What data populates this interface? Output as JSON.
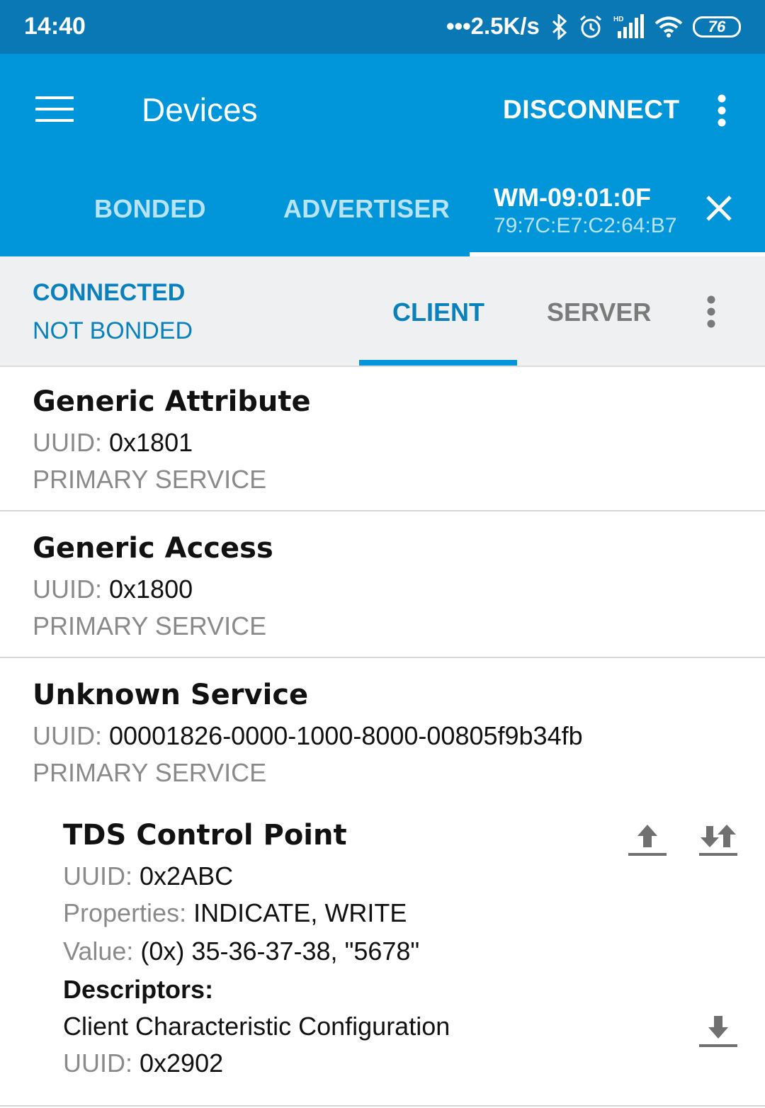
{
  "status_bar": {
    "time": "14:40",
    "network_speed": "•••2.5K/s",
    "battery": "76",
    "icons": [
      "bluetooth-icon",
      "alarm-icon",
      "signal-icon",
      "wifi-icon",
      "battery-icon"
    ]
  },
  "app_bar": {
    "title": "Devices",
    "disconnect_label": "DISCONNECT",
    "tabs": [
      {
        "label": "BONDED"
      },
      {
        "label": "ADVERTISER"
      }
    ],
    "device_tab": {
      "name": "WM-09:01:0F",
      "address": "79:7C:E7:C2:64:B7"
    }
  },
  "sub_bar": {
    "connection_state": "CONNECTED",
    "bond_state": "NOT BONDED",
    "tabs": [
      {
        "label": "CLIENT",
        "active": true
      },
      {
        "label": "SERVER",
        "active": false
      }
    ]
  },
  "uuid_label": "UUID:",
  "services": [
    {
      "name": "Generic Attribute",
      "uuid": "0x1801",
      "type": "PRIMARY SERVICE"
    },
    {
      "name": "Generic Access",
      "uuid": "0x1800",
      "type": "PRIMARY SERVICE"
    },
    {
      "name": "Unknown Service",
      "uuid": "00001826-0000-1000-8000-00805f9b34fb",
      "type": "PRIMARY SERVICE"
    }
  ],
  "characteristic": {
    "name": "TDS Control Point",
    "uuid_label": "UUID:",
    "uuid": "0x2ABC",
    "properties_label": "Properties:",
    "properties": "INDICATE, WRITE",
    "value_label": "Value:",
    "value": "(0x) 35-36-37-38, \"5678\"",
    "descriptors_label": "Descriptors:",
    "descriptor": {
      "name": "Client Characteristic Configuration",
      "uuid_label": "UUID:",
      "uuid": "0x2902"
    }
  },
  "colors": {
    "status_bar": "#0a78b4",
    "app_bar": "#0195d9",
    "accent": "#0a81bd",
    "sub_bar": "#eef0f1"
  }
}
